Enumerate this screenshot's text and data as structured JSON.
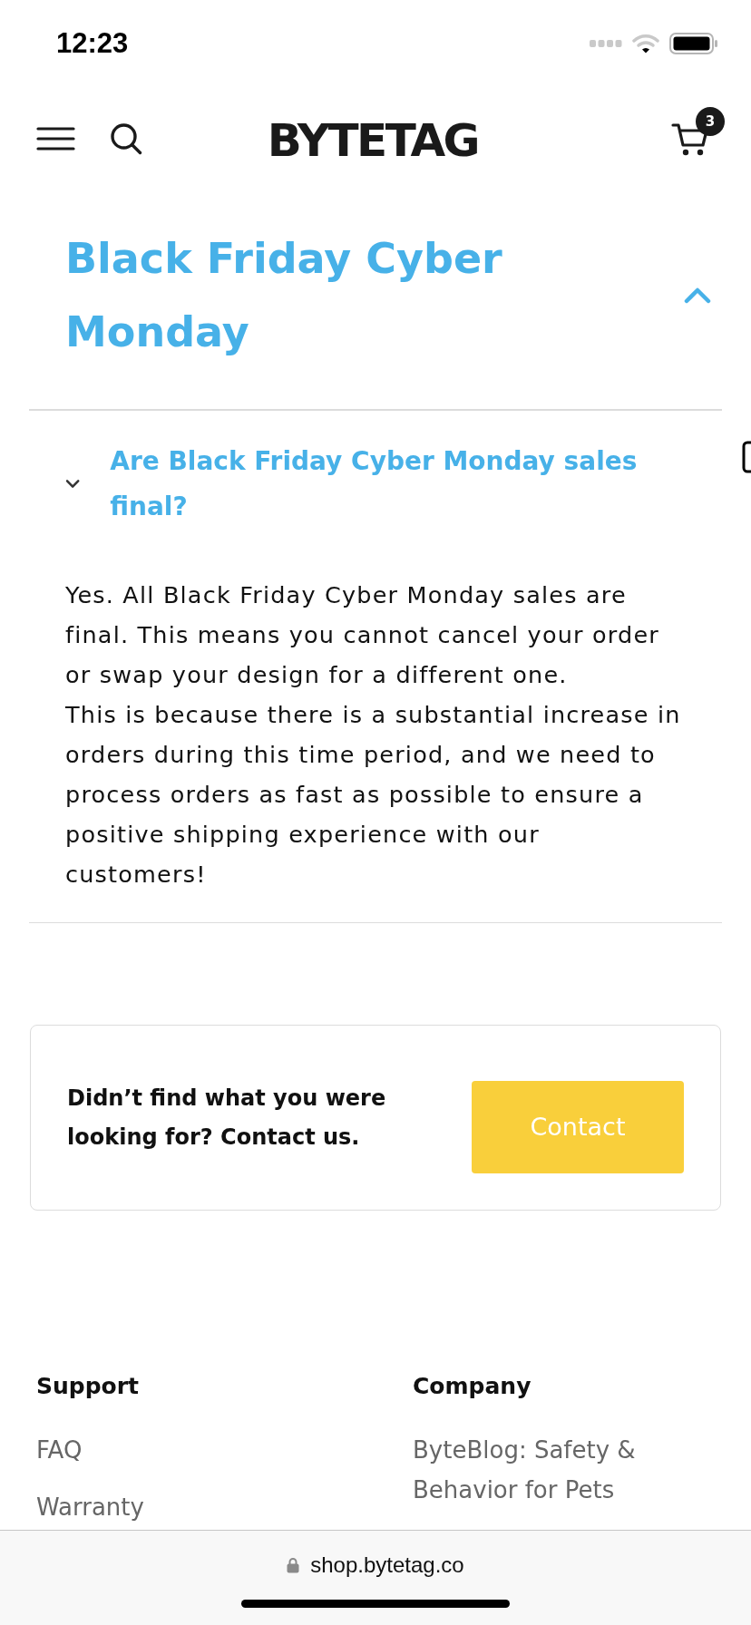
{
  "status_bar": {
    "time": "12:23"
  },
  "header": {
    "logo": "BYTETAG",
    "cart_count": "3"
  },
  "faq_section": {
    "title": "Black Friday Cyber Monday",
    "expanded": true,
    "questions": [
      {
        "question": "Are Black Friday Cyber Monday sales final?",
        "expanded": true,
        "answer": [
          "Yes. All Black Friday Cyber Monday sales are final. This means you cannot cancel your order or swap your design for a different one.",
          "This is because there is a substantial increase in orders during this time period, and we need to process orders as fast as possible to ensure a positive shipping experience with our customers!"
        ]
      }
    ]
  },
  "contact_card": {
    "text": "Didn’t find what you were looking for? Contact us.",
    "button": "Contact"
  },
  "footer": {
    "columns": [
      {
        "heading": "Support",
        "links": [
          "FAQ",
          "Warranty"
        ]
      },
      {
        "heading": "Company",
        "links": [
          "ByteBlog: Safety & Behavior for Pets"
        ]
      }
    ]
  },
  "browser_bar": {
    "url": "shop.bytetag.co"
  }
}
